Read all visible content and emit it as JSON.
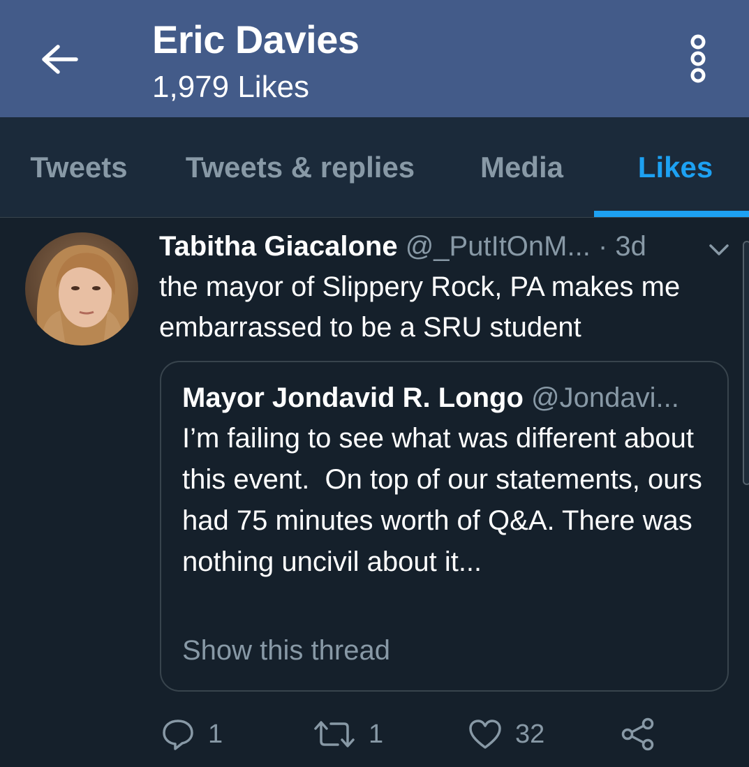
{
  "header": {
    "title": "Eric Davies",
    "subtitle": "1,979 Likes",
    "back_icon": "arrow-left-icon",
    "more_icon": "more-vertical-icon",
    "bg_color": "#435b89"
  },
  "tabs": [
    {
      "label": "Tweets",
      "active": false
    },
    {
      "label": "Tweets & replies",
      "active": false
    },
    {
      "label": "Media",
      "active": false
    },
    {
      "label": "Likes",
      "active": true
    }
  ],
  "accent_color": "#1da1f2",
  "tweet": {
    "author_name": "Tabitha Giacalone",
    "author_handle": "@_PutItOnM...",
    "time": "· 3d",
    "text": "the mayor of Slippery Rock, PA makes me embarrassed to be a SRU student",
    "quote": {
      "author_name": "Mayor Jondavid R. Longo",
      "author_handle": "@Jondavi...",
      "text": "I’m failing to see what was different about this event.  On top of our statements, ours had 75 minutes worth of Q&A. There was nothing uncivil about it...",
      "show_thread": "Show this thread"
    },
    "actions": {
      "reply_count": "1",
      "retweet_count": "1",
      "like_count": "32"
    }
  }
}
